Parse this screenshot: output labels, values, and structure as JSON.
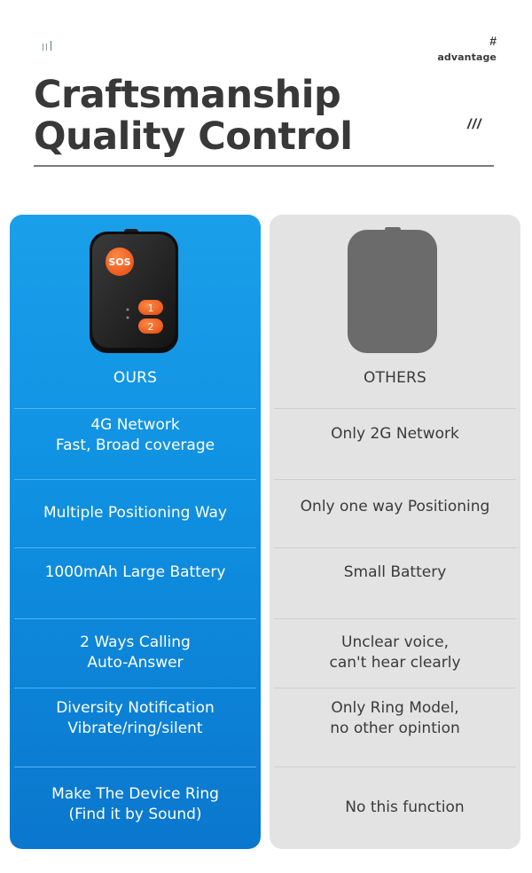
{
  "header": {
    "decoration": "bars",
    "hash": "#",
    "tag": "advantage",
    "title_line1": "Craftsmanship",
    "title_line2": "Quality Control",
    "slashes": "///"
  },
  "comparison": {
    "ours": {
      "label": "OURS",
      "device_image": "gps-tracker-device",
      "device_buttons": [
        "SOS",
        "1",
        "2"
      ],
      "accent": "#f26522",
      "rows": [
        "4G Network\nFast, Broad coverage",
        "Multiple Positioning Way",
        "1000mAh Large Battery",
        "2 Ways Calling\nAuto-Answer",
        "Diversity Notification\nVibrate/ring/silent",
        "Make The Device Ring\n(Find it by Sound)"
      ]
    },
    "others": {
      "label": "OTHERS",
      "device_image": "generic-device-silhouette",
      "rows": [
        "Only 2G Network",
        "Only one way Positioning",
        "Small Battery",
        "Unclear voice,\ncan't hear clearly",
        "Only Ring Model,\nno other opintion",
        "No this function"
      ]
    }
  },
  "colors": {
    "ours_panel_top": "#1a9fea",
    "ours_panel_bottom": "#0a77cd",
    "others_panel": "#e3e3e3",
    "title_text": "#383838"
  }
}
